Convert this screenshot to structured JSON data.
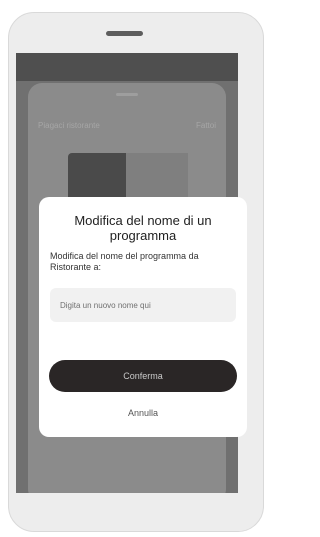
{
  "background": {
    "sheet_title": "Piagaci ristorante",
    "sheet_action": "Fattoi"
  },
  "dialog": {
    "title": "Modifica del nome di un programma",
    "message": "Modifica del nome del programma da Ristorante a:",
    "input": {
      "value": "",
      "placeholder": "Digita un nuovo nome qui"
    },
    "confirm_label": "Conferma",
    "cancel_label": "Annulla"
  },
  "colors": {
    "confirm_button": "#2a2626",
    "overlay": "#707070",
    "dialog": "#ffffff"
  }
}
